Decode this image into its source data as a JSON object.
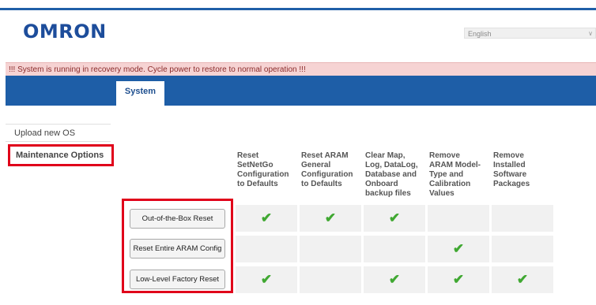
{
  "header": {
    "logo_text": "OMRON",
    "language_selected": "English",
    "brand_color": "#1e5ea7"
  },
  "banner": {
    "message": "!!! System is running in recovery mode. Cycle power to restore to normal operation !!!"
  },
  "nav": {
    "tabs": [
      {
        "label": "System",
        "active": true
      }
    ]
  },
  "sidebar": {
    "items": [
      {
        "label": "Upload new OS"
      },
      {
        "label": "Maintenance Options",
        "active": true
      }
    ]
  },
  "maintenance": {
    "columns": [
      {
        "lines": [
          "Reset",
          "SetNetGo",
          "Configuration",
          "to Defaults"
        ]
      },
      {
        "lines": [
          "Reset ARAM",
          "General",
          "Configuration",
          "to Defaults"
        ]
      },
      {
        "lines": [
          "Clear Map,",
          "Log, DataLog,",
          "Database and",
          "Onboard",
          "backup files"
        ]
      },
      {
        "lines": [
          "Remove",
          "ARAM Model-",
          "Type and",
          "Calibration",
          "Values"
        ]
      },
      {
        "lines": [
          "Remove",
          "Installed",
          "Software",
          "Packages"
        ]
      }
    ],
    "rows": [
      {
        "button": "Out-of-the-Box Reset",
        "checks": [
          true,
          true,
          true,
          false,
          false
        ]
      },
      {
        "button": "Reset Entire ARAM Config",
        "checks": [
          false,
          false,
          false,
          true,
          false
        ]
      },
      {
        "button": "Low-Level Factory Reset",
        "checks": [
          true,
          false,
          true,
          true,
          true
        ]
      }
    ],
    "check_color": "#40a832",
    "highlight_color": "#e0001a"
  }
}
